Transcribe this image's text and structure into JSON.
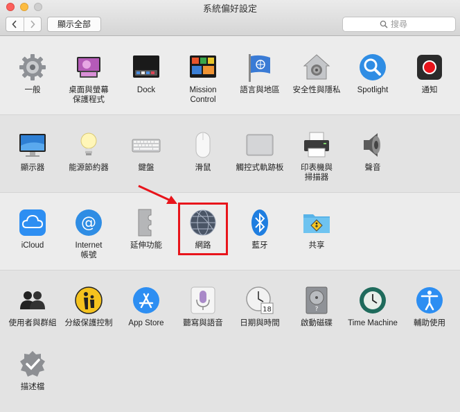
{
  "window": {
    "title": "系統偏好設定"
  },
  "toolbar": {
    "show_all_label": "顯示全部",
    "search_placeholder": "搜尋",
    "back_icon": "chevron-left-icon",
    "forward_icon": "chevron-right-icon"
  },
  "sections": [
    {
      "items": [
        {
          "label": "一般",
          "icon": "general-gear-icon"
        },
        {
          "label": "桌面與螢幕\n保護程式",
          "icon": "desktop-screensaver-icon"
        },
        {
          "label": "Dock",
          "icon": "dock-icon"
        },
        {
          "label": "Mission\nControl",
          "icon": "mission-control-icon"
        },
        {
          "label": "語言與地區",
          "icon": "language-region-flag-icon"
        },
        {
          "label": "安全性與隱私",
          "icon": "security-house-icon"
        },
        {
          "label": "Spotlight",
          "icon": "spotlight-magnifier-icon"
        },
        {
          "label": "通知",
          "icon": "notifications-icon"
        }
      ]
    },
    {
      "items": [
        {
          "label": "顯示器",
          "icon": "display-monitor-icon"
        },
        {
          "label": "能源節約器",
          "icon": "energy-saver-bulb-icon"
        },
        {
          "label": "鍵盤",
          "icon": "keyboard-icon"
        },
        {
          "label": "滑鼠",
          "icon": "mouse-icon"
        },
        {
          "label": "觸控式軌跡板",
          "icon": "trackpad-icon"
        },
        {
          "label": "印表機與\n掃描器",
          "icon": "printer-icon"
        },
        {
          "label": "聲音",
          "icon": "speaker-icon"
        }
      ]
    },
    {
      "items": [
        {
          "label": "iCloud",
          "icon": "icloud-icon"
        },
        {
          "label": "Internet\n帳號",
          "icon": "internet-accounts-at-icon"
        },
        {
          "label": "延伸功能",
          "icon": "extensions-puzzle-icon"
        },
        {
          "label": "網路",
          "icon": "network-globe-icon"
        },
        {
          "label": "藍牙",
          "icon": "bluetooth-icon"
        },
        {
          "label": "共享",
          "icon": "sharing-folder-icon"
        }
      ]
    },
    {
      "items": [
        {
          "label": "使用者與群組",
          "icon": "users-groups-icon"
        },
        {
          "label": "分級保護控制",
          "icon": "parental-controls-icon"
        },
        {
          "label": "App Store",
          "icon": "app-store-icon"
        },
        {
          "label": "聽寫與語音",
          "icon": "dictation-microphone-icon"
        },
        {
          "label": "日期與時間",
          "icon": "date-time-clock-icon"
        },
        {
          "label": "啟動磁碟",
          "icon": "startup-disk-icon"
        },
        {
          "label": "Time Machine",
          "icon": "time-machine-icon"
        },
        {
          "label": "輔助使用",
          "icon": "accessibility-icon"
        }
      ]
    },
    {
      "items": [
        {
          "label": "描述檔",
          "icon": "profiles-badge-icon"
        }
      ]
    }
  ],
  "annotation": {
    "highlighted_item": "網路",
    "highlight_color": "#e8141b"
  }
}
